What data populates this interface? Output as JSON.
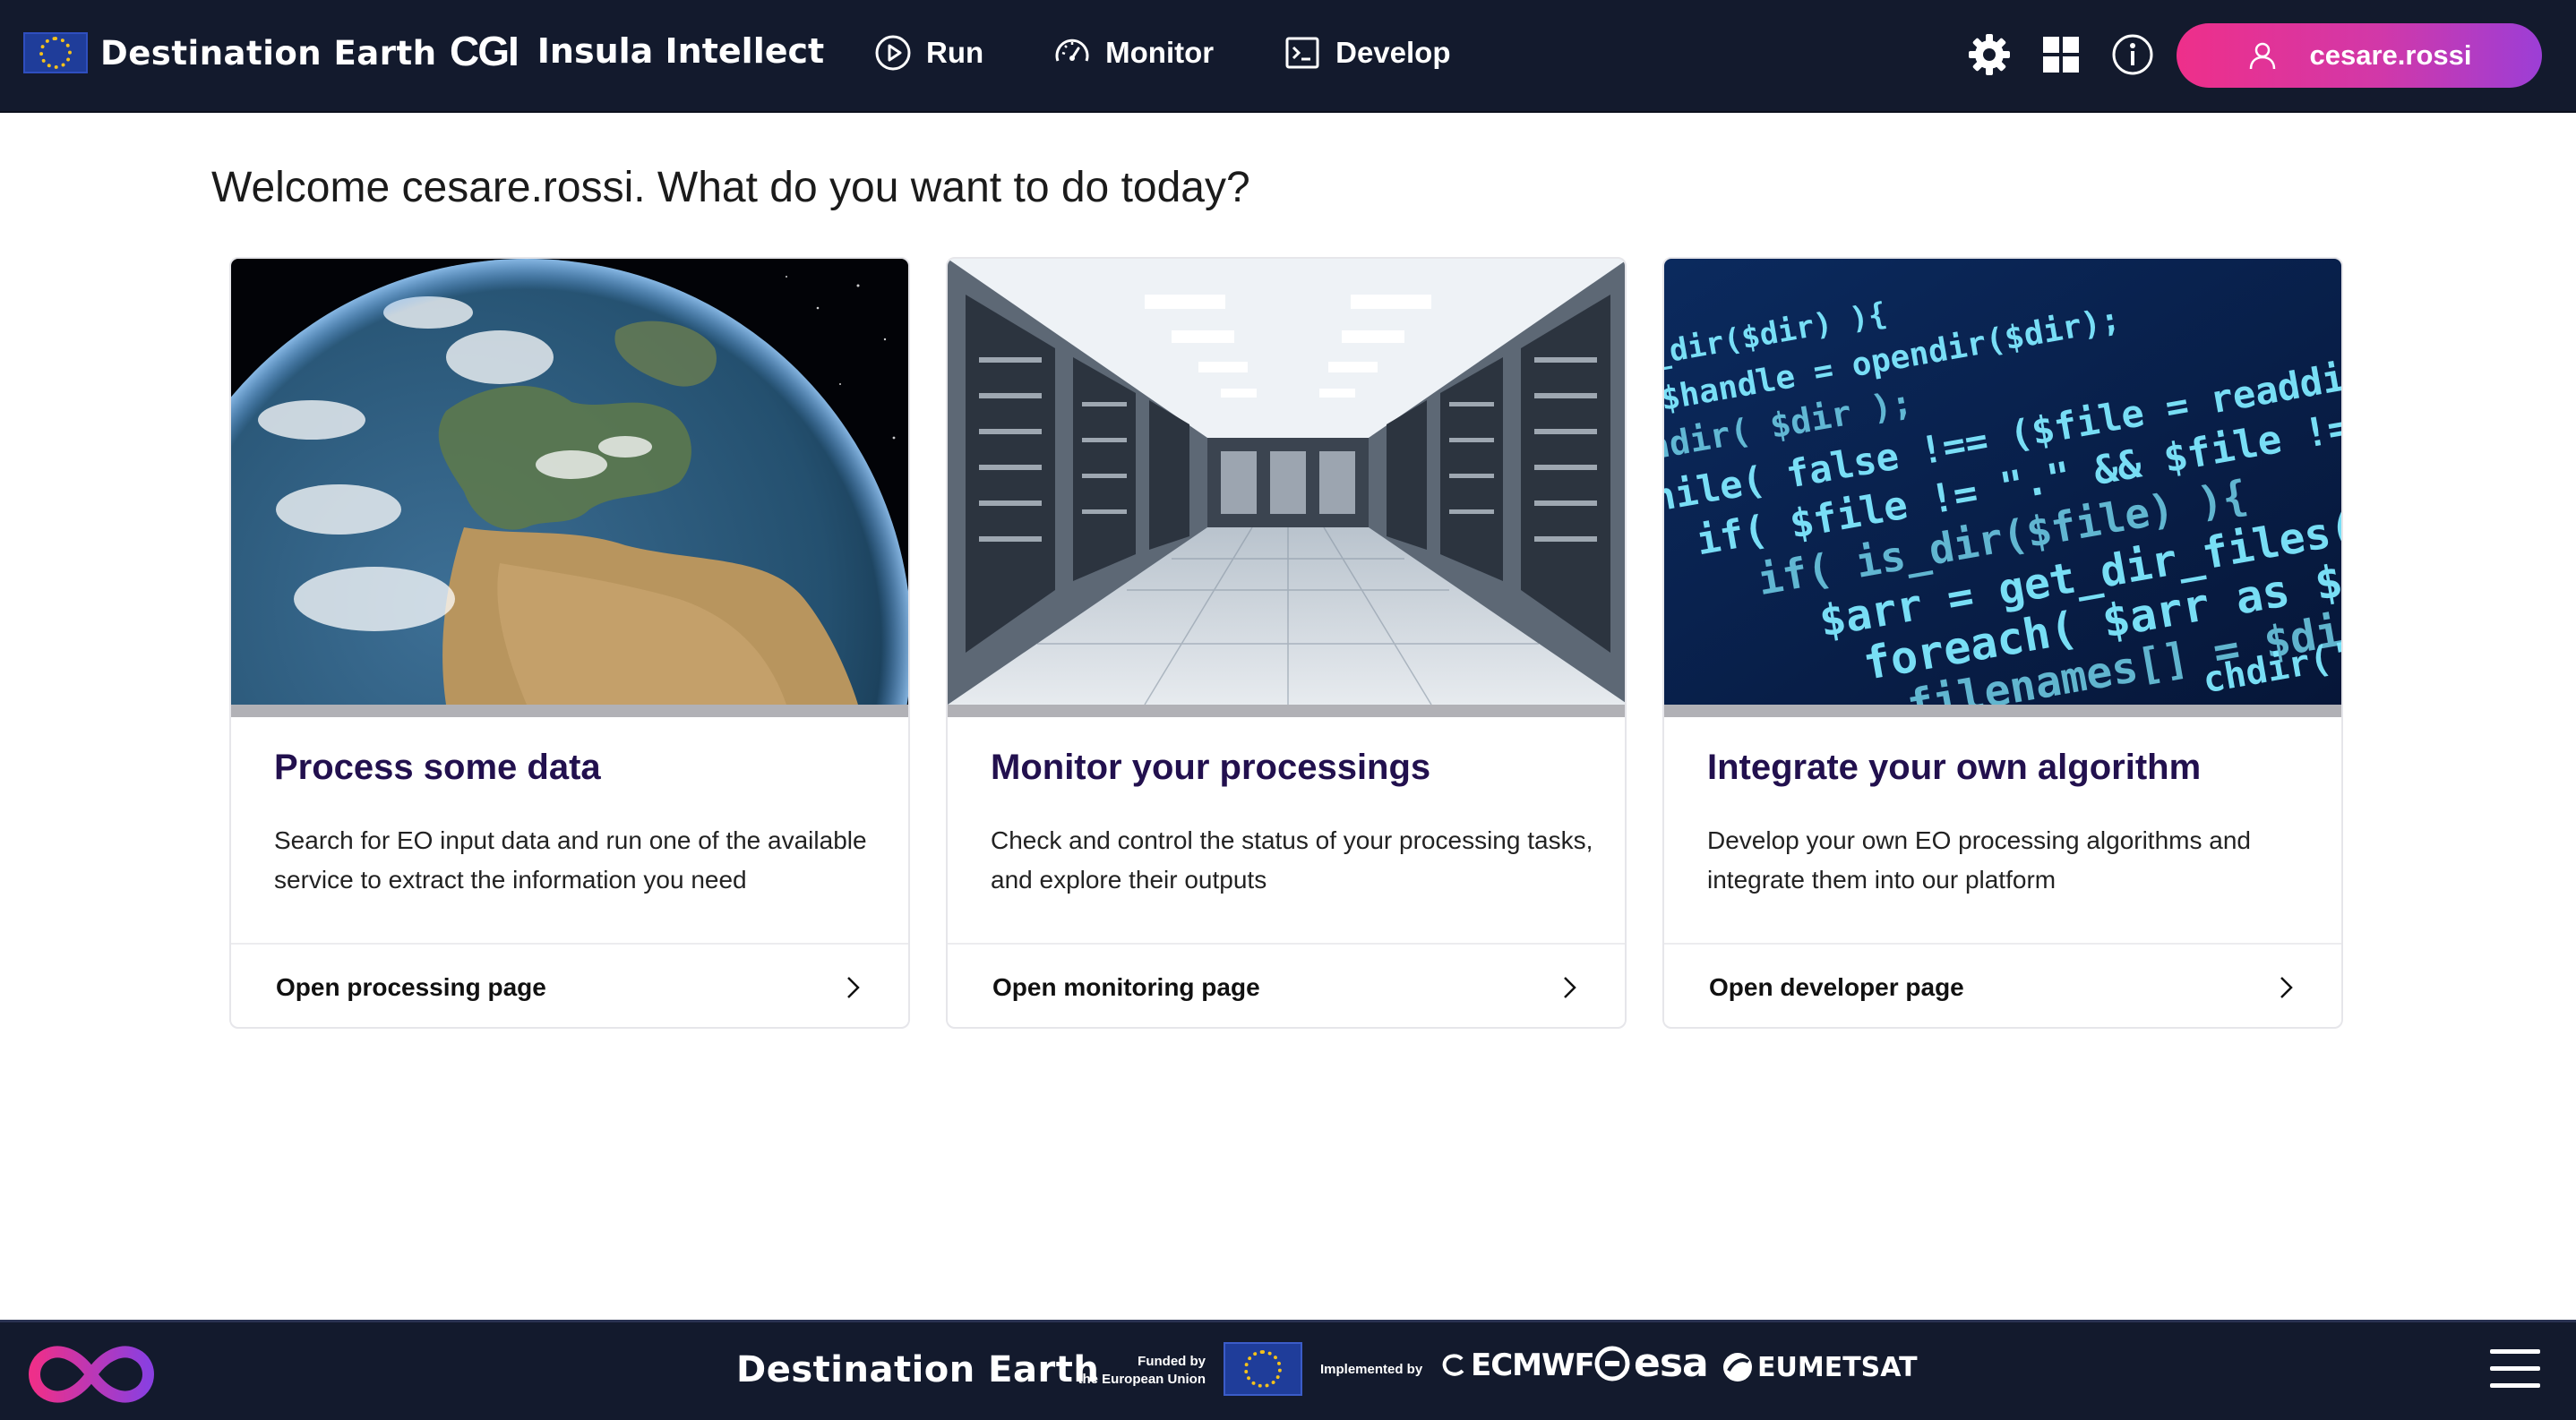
{
  "header": {
    "brand_name": "Destination Earth",
    "partner_logo": "CGI",
    "app_name": "Insula Intellect",
    "nav": [
      {
        "label": "Run",
        "icon": "play-circle-icon"
      },
      {
        "label": "Monitor",
        "icon": "gauge-icon"
      },
      {
        "label": "Develop",
        "icon": "terminal-icon"
      }
    ],
    "icons": [
      "gear-icon",
      "apps-grid-icon",
      "info-icon"
    ],
    "user": {
      "name": "cesare.rossi",
      "icon": "user-icon"
    },
    "colors": {
      "bar": "#131a2d",
      "user_gradient_start": "#ee2f8a",
      "user_gradient_end": "#9c3ed6"
    }
  },
  "welcome": "Welcome cesare.rossi. What do you want to do today?",
  "cards": [
    {
      "title": "Process some data",
      "description": "Search for EO input data and run one of the available service to extract the information you need",
      "action": "Open processing page",
      "image": "earth-globe"
    },
    {
      "title": "Monitor your processings",
      "description": "Check and control the status of your processing tasks, and explore their outputs",
      "action": "Open monitoring page",
      "image": "data-center"
    },
    {
      "title": "Integrate your own algorithm",
      "description": "Develop your own EO processing algorithms and integrate them into our platform",
      "action": "Open developer page",
      "image": "code-screen"
    }
  ],
  "code_lines": [
    "s_dir($dir) ){",
    "$handle = opendir($dir);",
    "ndir( $dir );",
    "hile( false !== ($file = readdir($handle",
    "if( $file != \".\" && $file !=",
    "if( is_dir($file) ){",
    "$arr = get_dir_files( $file",
    "foreach( $arr as $value ) $filename",
    "filenames[] = $dir.'/'.$v",
    "chdir('../');"
  ],
  "footer": {
    "brand": "Destination Earth",
    "funded_by": "Funded by",
    "funded_by_2": "the European Union",
    "implemented_by": "Implemented by",
    "partners": [
      "ECMWF",
      "esa",
      "EUMETSAT"
    ],
    "menu_icon": "hamburger-menu-icon"
  }
}
